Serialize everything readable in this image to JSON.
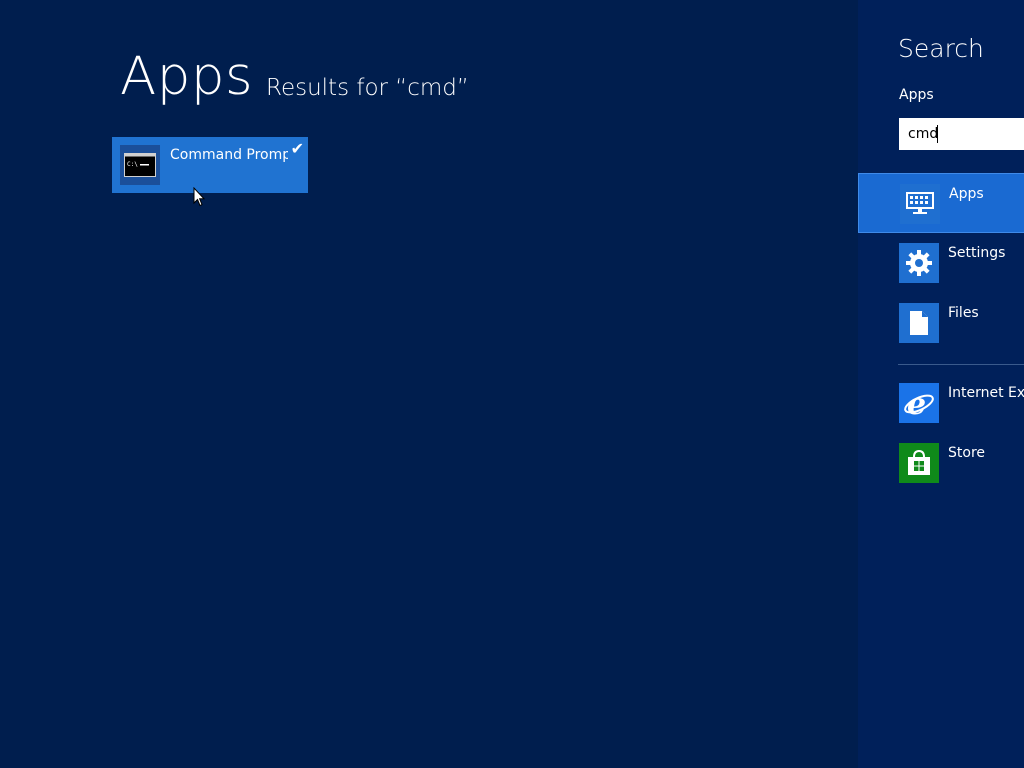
{
  "main": {
    "heading": "Apps",
    "subheading": "Results for “cmd”",
    "results": [
      {
        "label": "Command Prompt",
        "selected": true,
        "icon": "command-prompt-icon"
      }
    ]
  },
  "charm": {
    "title": "Search",
    "scope_label": "Apps",
    "search_value": "cmd",
    "categories": [
      {
        "label": "Apps",
        "icon": "apps-keyboard-icon",
        "color": "#1f6fd0",
        "selected": true
      },
      {
        "label": "Settings",
        "icon": "gear-icon",
        "color": "#1f6fd0"
      },
      {
        "label": "Files",
        "icon": "file-icon",
        "color": "#1f6fd0"
      }
    ],
    "apps": [
      {
        "label": "Internet Explorer",
        "icon": "internet-explorer-icon",
        "color": "#1a73e8"
      },
      {
        "label": "Store",
        "icon": "store-bag-icon",
        "color": "#0f8a1a"
      }
    ]
  },
  "colors": {
    "background": "#001e4e",
    "charm_background": "#00205a",
    "accent": "#2073d1",
    "selected": "#1a6ad2"
  }
}
